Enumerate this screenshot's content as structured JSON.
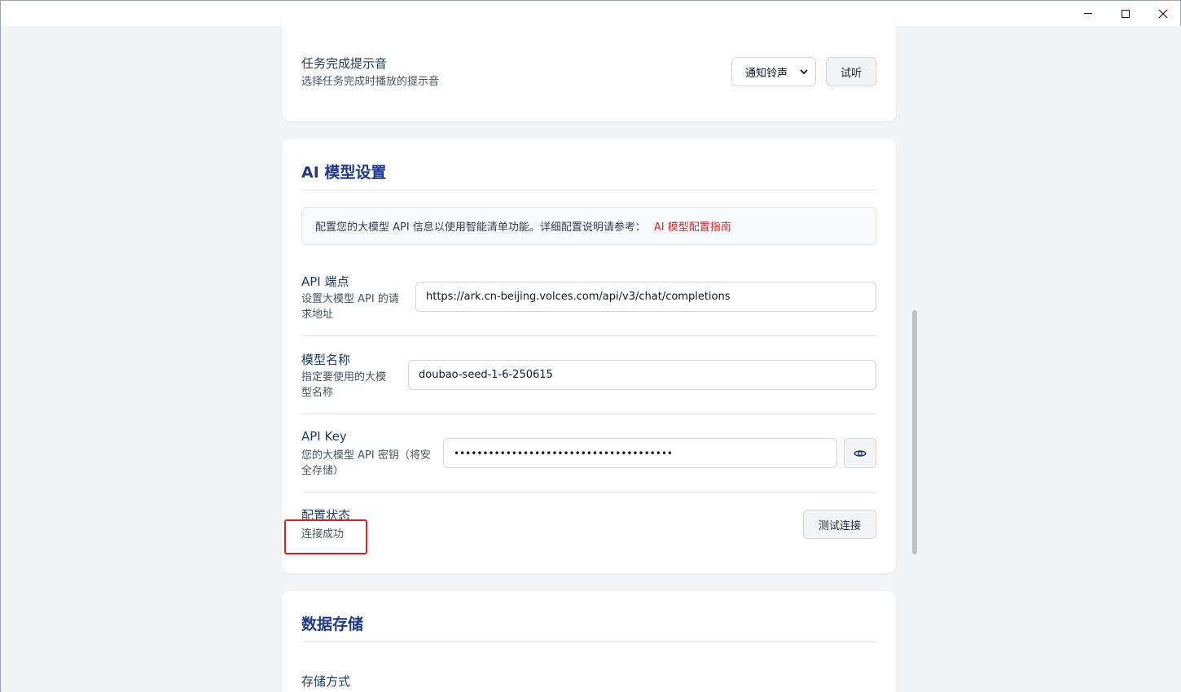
{
  "window": {
    "controls": [
      "minimize",
      "maximize",
      "close"
    ]
  },
  "notification_card": {
    "title": "任务完成提示音",
    "description": "选择任务完成时播放的提示音",
    "sound_select_value": "通知铃声",
    "listen_button": "试听"
  },
  "ai_settings": {
    "section_title": "AI 模型设置",
    "info_text": "配置您的大模型 API 信息以使用智能清单功能。详细配置说明请参考：",
    "info_link": "AI 模型配置指南",
    "api_endpoint": {
      "title": "API 端点",
      "description_line1": "设置大模型 API 的请",
      "description_line2": "求地址",
      "value": "https://ark.cn-beijing.volces.com/api/v3/chat/completions"
    },
    "model_name": {
      "title": "模型名称",
      "description_line1": "指定要使用的大模",
      "description_line2": "型名称",
      "value": "doubao-seed-1-6-250615"
    },
    "api_key": {
      "title": "API Key",
      "description_line1": "您的大模型 API 密钥（将安",
      "description_line2": "全存储）",
      "masked_value": "••••••••••••••••••••••••••••••••••••••"
    },
    "config_status": {
      "title": "配置状态",
      "status_text": "连接成功",
      "test_button": "测试连接"
    }
  },
  "data_storage": {
    "section_title": "数据存储",
    "storage_method_title": "存储方式"
  },
  "colors": {
    "accent_title": "#1e3a8a",
    "link": "#dc2626",
    "highlight": "#e02020"
  }
}
